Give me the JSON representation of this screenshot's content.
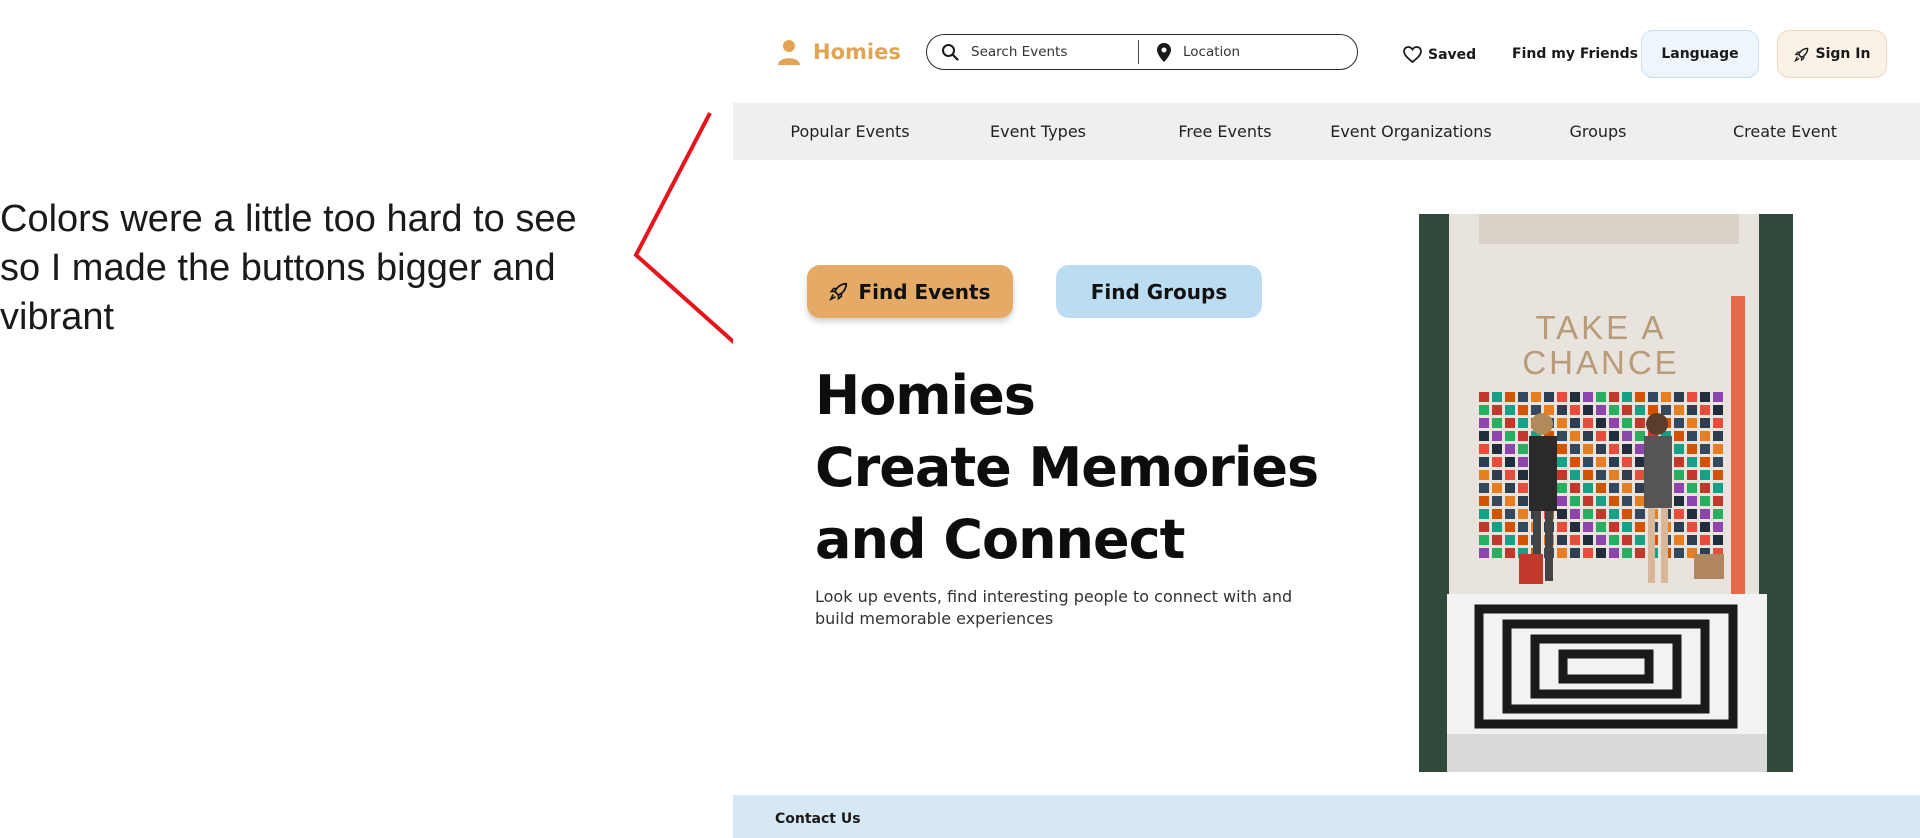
{
  "annotation": {
    "lines": [
      "Colors were a little too hard to see",
      "so I made the buttons bigger and",
      "vibrant"
    ]
  },
  "header": {
    "brand": "Homies",
    "search": {
      "events_placeholder": "Search Events",
      "location_placeholder": "Location"
    },
    "saved": "Saved",
    "find_friends": "Find my Friends",
    "language": "Language",
    "sign_in": "Sign In"
  },
  "nav": {
    "items": [
      "Popular Events",
      "Event Types",
      "Free Events",
      "Event Organizations",
      "Groups",
      "Create Event"
    ]
  },
  "hero": {
    "find_events": "Find Events",
    "find_groups": "Find Groups",
    "headline": [
      "Homies",
      "Create Memories",
      "and Connect"
    ],
    "subtext": "Look up events, find interesting people to connect with and build memorable experiences",
    "photo_sign": {
      "line1": "TAKE A",
      "line2": "CHANCE"
    }
  },
  "footer": {
    "contact": "Contact Us"
  },
  "colors": {
    "brand": "#e2a453",
    "find_events_bg": "#e5aa65",
    "find_groups_bg": "#bcdcf1",
    "nav_bg": "#efefef",
    "footer_bg": "#d6e8f4",
    "annotation_line": "#e8141b"
  },
  "icons": {
    "brand": "person-icon",
    "search": "search-icon",
    "location": "location-pin-icon",
    "saved": "heart-icon",
    "sign_in": "rocket-icon",
    "find_events": "rocket-icon"
  }
}
